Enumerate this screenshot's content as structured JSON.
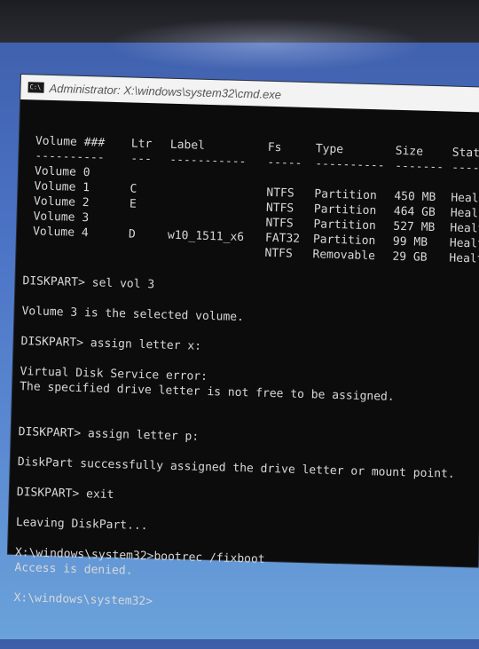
{
  "window": {
    "title": "Administrator: X:\\windows\\system32\\cmd.exe",
    "icon": "cmd-icon"
  },
  "volume_table": {
    "headers": {
      "volume": "Volume ###",
      "ltr": "Ltr",
      "label": "Label",
      "fs": "Fs",
      "type": "Type",
      "size": "Size",
      "status": "Stat"
    },
    "separators": {
      "volume": "----------",
      "ltr": "---",
      "label": "-----------",
      "fs": "-----",
      "type": "----------",
      "size": "-------",
      "status": "----"
    },
    "rows": [
      {
        "volume": "Volume 0",
        "ltr": "",
        "label": "",
        "fs": "",
        "type": "",
        "size": "",
        "status": ""
      },
      {
        "volume": "Volume 1",
        "ltr": "C",
        "label": "",
        "fs": "NTFS",
        "type": "Partition",
        "size": "450 MB",
        "status": "Heal"
      },
      {
        "volume": "Volume 2",
        "ltr": "E",
        "label": "",
        "fs": "NTFS",
        "type": "Partition",
        "size": "464 GB",
        "status": "Heal"
      },
      {
        "volume": "Volume 3",
        "ltr": "",
        "label": "",
        "fs": "NTFS",
        "type": "Partition",
        "size": "527 MB",
        "status": "Healt"
      },
      {
        "volume": "Volume 4",
        "ltr": "D",
        "label": "w10_1511_x6",
        "fs": "FAT32",
        "type": "Partition",
        "size": "99 MB",
        "status": "Healt"
      },
      {
        "volume": "",
        "ltr": "",
        "label": "",
        "fs": "NTFS",
        "type": "Removable",
        "size": "29 GB",
        "status": "Healt"
      }
    ]
  },
  "console_lines": [
    "DISKPART> sel vol 3",
    "",
    "Volume 3 is the selected volume.",
    "",
    "DISKPART> assign letter x:",
    "",
    "Virtual Disk Service error:",
    "The specified drive letter is not free to be assigned.",
    "",
    "",
    "DISKPART> assign letter p:",
    "",
    "DiskPart successfully assigned the drive letter or mount point.",
    "",
    "DISKPART> exit",
    "",
    "Leaving DiskPart...",
    "",
    "X:\\windows\\system32>bootrec /fixboot",
    "Access is denied.",
    "",
    "X:\\windows\\system32>"
  ]
}
